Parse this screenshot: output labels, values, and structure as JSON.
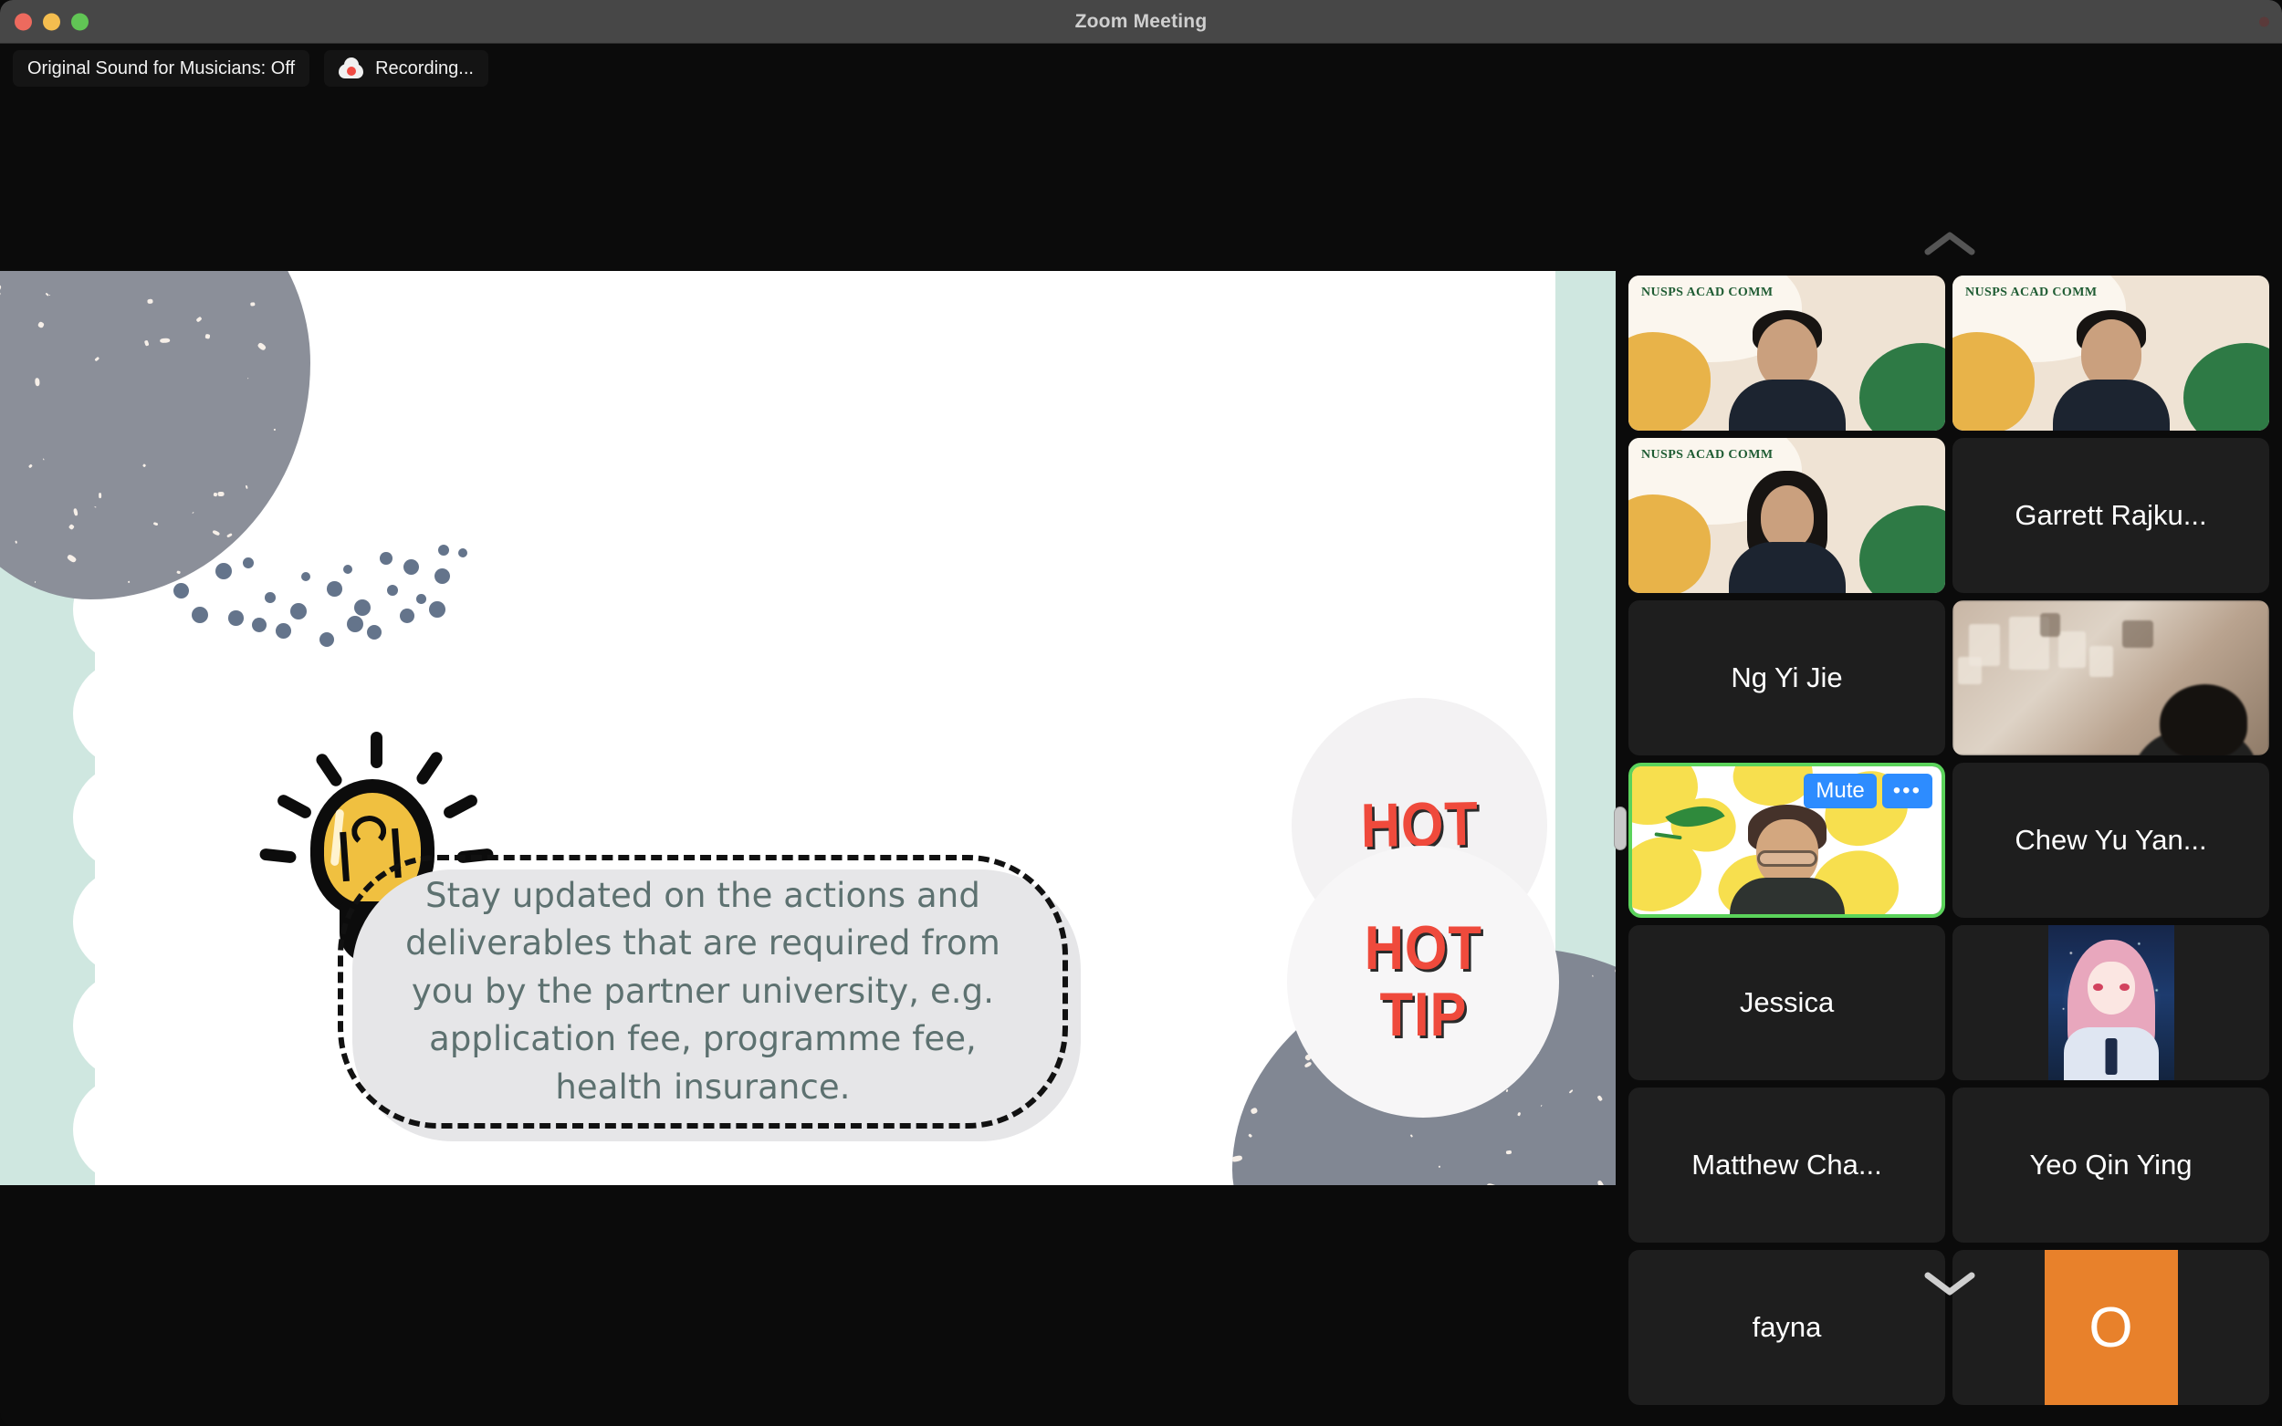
{
  "window": {
    "title": "Zoom Meeting",
    "traffic_lights": [
      "close-button",
      "minimize-button",
      "maximize-button"
    ]
  },
  "statusbar": {
    "original_sound_label": "Original Sound for Musicians: Off",
    "recording_label": "Recording...",
    "recording_icon": "cloud-record-icon"
  },
  "slide": {
    "body_text": "Stay updated on the actions and deliverables that are required from you by the partner university, e.g. application fee, programme fee, health insurance.",
    "badge_top": "HOT",
    "badge_bottom_line1": "HOT",
    "badge_bottom_line2": "TIP",
    "colors": {
      "mint": "#cfe7e0",
      "grey_blob": "#8b8f99",
      "bubble_fill": "#e6e6e8",
      "text": "#5d7170",
      "bulb_yellow": "#f0c040",
      "badge_red": "#ef4a3c",
      "cap_green": "#8aada0"
    }
  },
  "strip": {
    "scroll_up_icon": "chevron-up-icon",
    "scroll_down_icon": "chevron-down-icon",
    "active_tile": {
      "mute_label": "Mute",
      "more_label": "•••",
      "border_color": "#5bd35b"
    },
    "tiles": [
      {
        "kind": "video",
        "background": "nusps",
        "overlay_text": "NUSPS ACAD COMM"
      },
      {
        "kind": "video",
        "background": "nusps",
        "overlay_text": "NUSPS ACAD COMM"
      },
      {
        "kind": "video",
        "background": "nusps",
        "overlay_text": "NUSPS ACAD COMM"
      },
      {
        "kind": "name",
        "name": "Garrett Rajku..."
      },
      {
        "kind": "name",
        "name": "Ng Yi Jie"
      },
      {
        "kind": "video",
        "background": "room",
        "overlay_text": ""
      },
      {
        "kind": "video",
        "background": "lemon",
        "overlay_text": "",
        "active": true
      },
      {
        "kind": "name",
        "name": "Chew Yu Yan..."
      },
      {
        "kind": "name",
        "name": "Jessica"
      },
      {
        "kind": "avatar-image",
        "background": "anime",
        "overlay_text": ""
      },
      {
        "kind": "name",
        "name": "Matthew Cha..."
      },
      {
        "kind": "name",
        "name": "Yeo Qin Ying"
      },
      {
        "kind": "name",
        "name": "fayna"
      },
      {
        "kind": "avatar-letter",
        "letter": "O",
        "color": "#e8812b"
      }
    ]
  }
}
